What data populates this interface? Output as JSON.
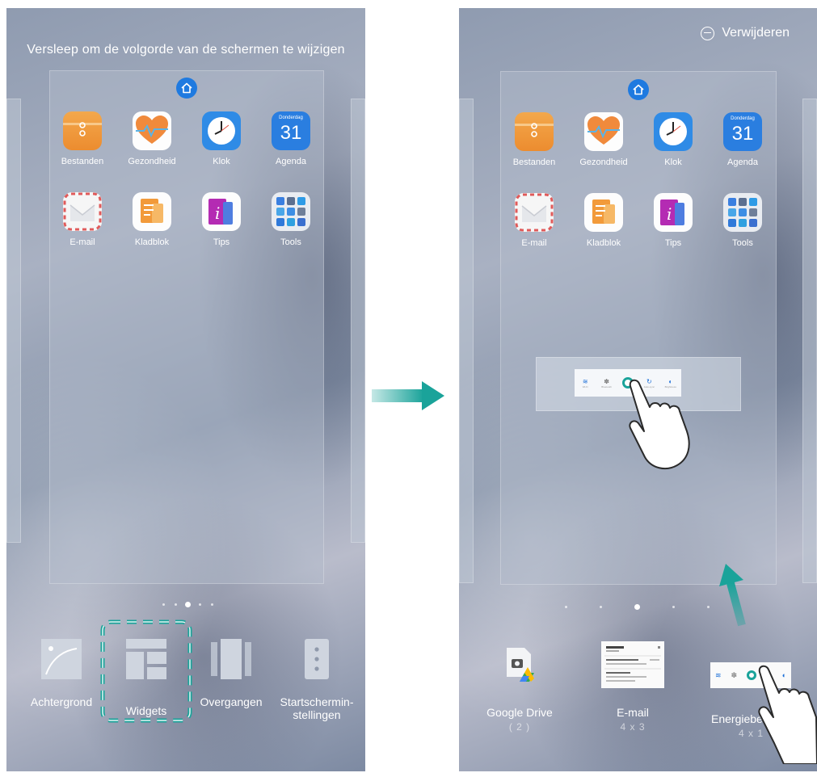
{
  "left_screen": {
    "hint": "Versleep om de volgorde van de schermen te wijzigen",
    "apps": [
      {
        "label": "Bestanden"
      },
      {
        "label": "Gezondheid"
      },
      {
        "label": "Klok"
      },
      {
        "label": "Agenda"
      },
      {
        "label": "E-mail"
      },
      {
        "label": "Kladblok"
      },
      {
        "label": "Tips"
      },
      {
        "label": "Tools"
      }
    ],
    "agenda": {
      "day": "Donderdag",
      "date": "31"
    },
    "options": [
      {
        "label": "Achtergrond"
      },
      {
        "label": "Widgets"
      },
      {
        "label": "Overgangen"
      },
      {
        "label_line1": "Startschermin-",
        "label_line2": "stellingen"
      }
    ]
  },
  "right_screen": {
    "remove_label": "Verwijderen",
    "apps": [
      {
        "label": "Bestanden"
      },
      {
        "label": "Gezondheid"
      },
      {
        "label": "Klok"
      },
      {
        "label": "Agenda"
      },
      {
        "label": "E-mail"
      },
      {
        "label": "Kladblok"
      },
      {
        "label": "Tips"
      },
      {
        "label": "Tools"
      }
    ],
    "agenda": {
      "day": "Donderdag",
      "date": "31"
    },
    "widget_toggles": [
      {
        "label": "Wi-Fi"
      },
      {
        "label": "Bluetooth"
      },
      {
        "label": ""
      },
      {
        "label": "Auto-sync"
      },
      {
        "label": "Brightness"
      }
    ],
    "widget_previews": [
      {
        "name": "Google Drive",
        "size": "( 2 )"
      },
      {
        "name": "E-mail",
        "size": "4 x 3"
      },
      {
        "name": "Energiebe",
        "size": "4 x 1"
      }
    ]
  },
  "colors": {
    "highlight": "#1aa39a",
    "arrow": "#1aa39a",
    "home_badge": "#1f7ae0"
  }
}
